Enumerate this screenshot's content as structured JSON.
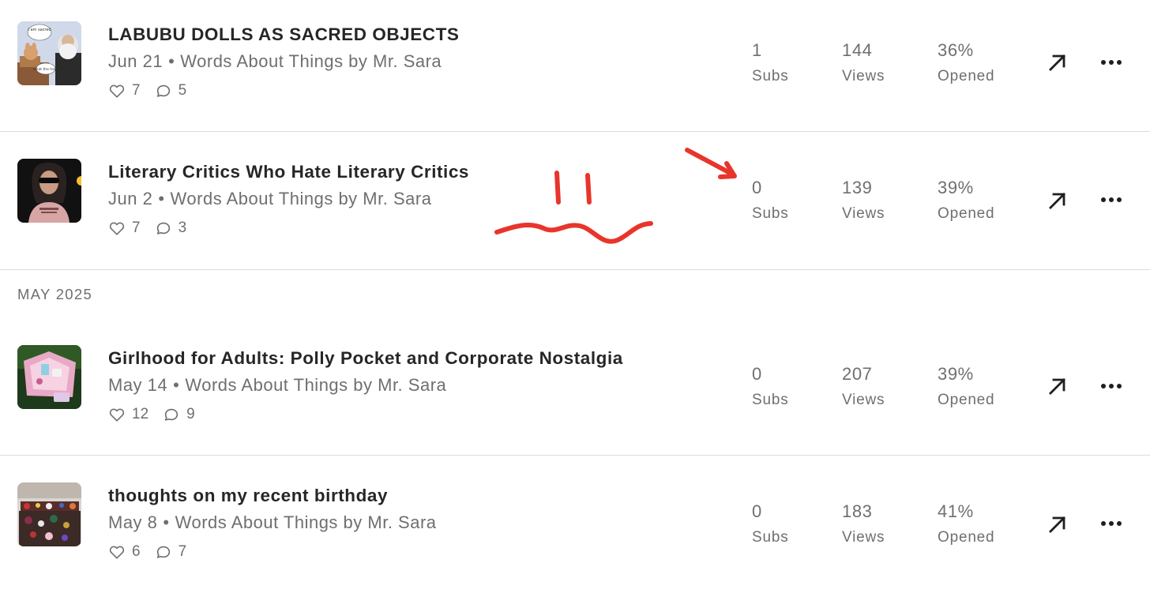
{
  "posts": [
    {
      "title": "LABUBU DOLLS AS SACRED OBJECTS",
      "date": "Jun 21",
      "publication": "Words About Things by Mr. Sara",
      "likes": "7",
      "comments": "5",
      "subs_value": "1",
      "subs_label": "Subs",
      "views_value": "144",
      "views_label": "Views",
      "opened_value": "36%",
      "opened_label": "Opened",
      "thumb_text_1": "I am sacred",
      "thumb_text_2": "what the heck"
    },
    {
      "title": "Literary Critics Who Hate Literary Critics",
      "date": "Jun 2",
      "publication": "Words About Things by Mr. Sara",
      "likes": "7",
      "comments": "3",
      "subs_value": "0",
      "subs_label": "Subs",
      "views_value": "139",
      "views_label": "Views",
      "opened_value": "39%",
      "opened_label": "Opened"
    },
    {
      "title": "Girlhood for Adults: Polly Pocket and Corporate Nostalgia",
      "date": "May 14",
      "publication": "Words About Things by Mr. Sara",
      "likes": "12",
      "comments": "9",
      "subs_value": "0",
      "subs_label": "Subs",
      "views_value": "207",
      "views_label": "Views",
      "opened_value": "39%",
      "opened_label": "Opened"
    },
    {
      "title": "thoughts on my recent birthday",
      "date": "May 8",
      "publication": "Words About Things by Mr. Sara",
      "likes": "6",
      "comments": "7",
      "subs_value": "0",
      "subs_label": "Subs",
      "views_value": "183",
      "views_label": "Views",
      "opened_value": "41%",
      "opened_label": "Opened"
    }
  ],
  "section_header": "MAY 2025",
  "meta_separator": "•",
  "icons": {
    "like": "heart-icon",
    "comment": "comment-bubble-icon",
    "open": "arrow-up-right-icon",
    "more": "ellipsis-icon"
  },
  "colors": {
    "annotation": "#e8352b",
    "divider": "#dcdcdc",
    "muted_text": "#6f6f6f",
    "title_text": "#262626"
  }
}
